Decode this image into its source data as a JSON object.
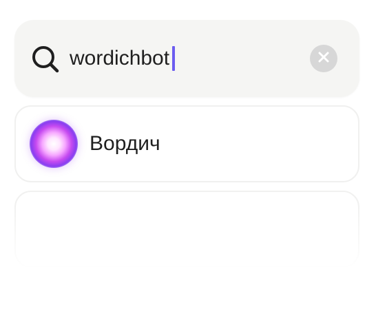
{
  "search": {
    "query": "wordichbot",
    "icon": "search-icon",
    "clear_icon": "close-icon",
    "caret_color": "#6b5cf0"
  },
  "results": [
    {
      "name": "Вордич",
      "avatar": "glowing-orb-avatar"
    }
  ],
  "colors": {
    "search_bg": "#f5f5f3",
    "clear_bg": "#d7d7d7",
    "avatar_accent": "#c64af0"
  }
}
